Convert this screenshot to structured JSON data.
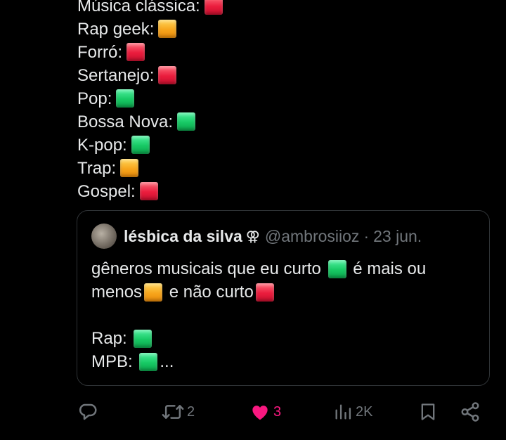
{
  "genres": [
    {
      "label": "Música clássica:",
      "rating": "red"
    },
    {
      "label": "Rap geek:",
      "rating": "yellow"
    },
    {
      "label": "Forró:",
      "rating": "red"
    },
    {
      "label": "Sertanejo:",
      "rating": "red"
    },
    {
      "label": "Pop:",
      "rating": "green"
    },
    {
      "label": "Bossa Nova:",
      "rating": "green"
    },
    {
      "label": "K-pop:",
      "rating": "green"
    },
    {
      "label": "Trap:",
      "rating": "yellow"
    },
    {
      "label": "Gospel:",
      "rating": "red"
    }
  ],
  "quote": {
    "name": "lésbica da silva",
    "name_symbol": "⚢",
    "handle": "@ambrosiioz",
    "separator": "·",
    "date": "23 jun.",
    "line1_a": "gêneros musicais que eu curto",
    "line1_b": "é mais ou",
    "line2_a": "menos",
    "line2_b": "e não curto",
    "rap_label": "Rap:",
    "mpb_label": "MPB:",
    "mpb_ellipsis": "..."
  },
  "actions": {
    "reply_count": "",
    "repost_count": "2",
    "like_count": "3",
    "views_count": "2K"
  },
  "icons": {
    "reply": "reply-icon",
    "repost": "repost-icon",
    "like": "heart-icon",
    "views": "views-icon",
    "bookmark": "bookmark-icon",
    "share": "share-icon"
  },
  "colors": {
    "background": "#000000",
    "text": "#e7e9ea",
    "muted": "#71767b",
    "like": "#f91880",
    "border": "#2f3336",
    "red_square": "#ea1c3d",
    "yellow_square": "#f7a51c",
    "green_square": "#17c964"
  }
}
